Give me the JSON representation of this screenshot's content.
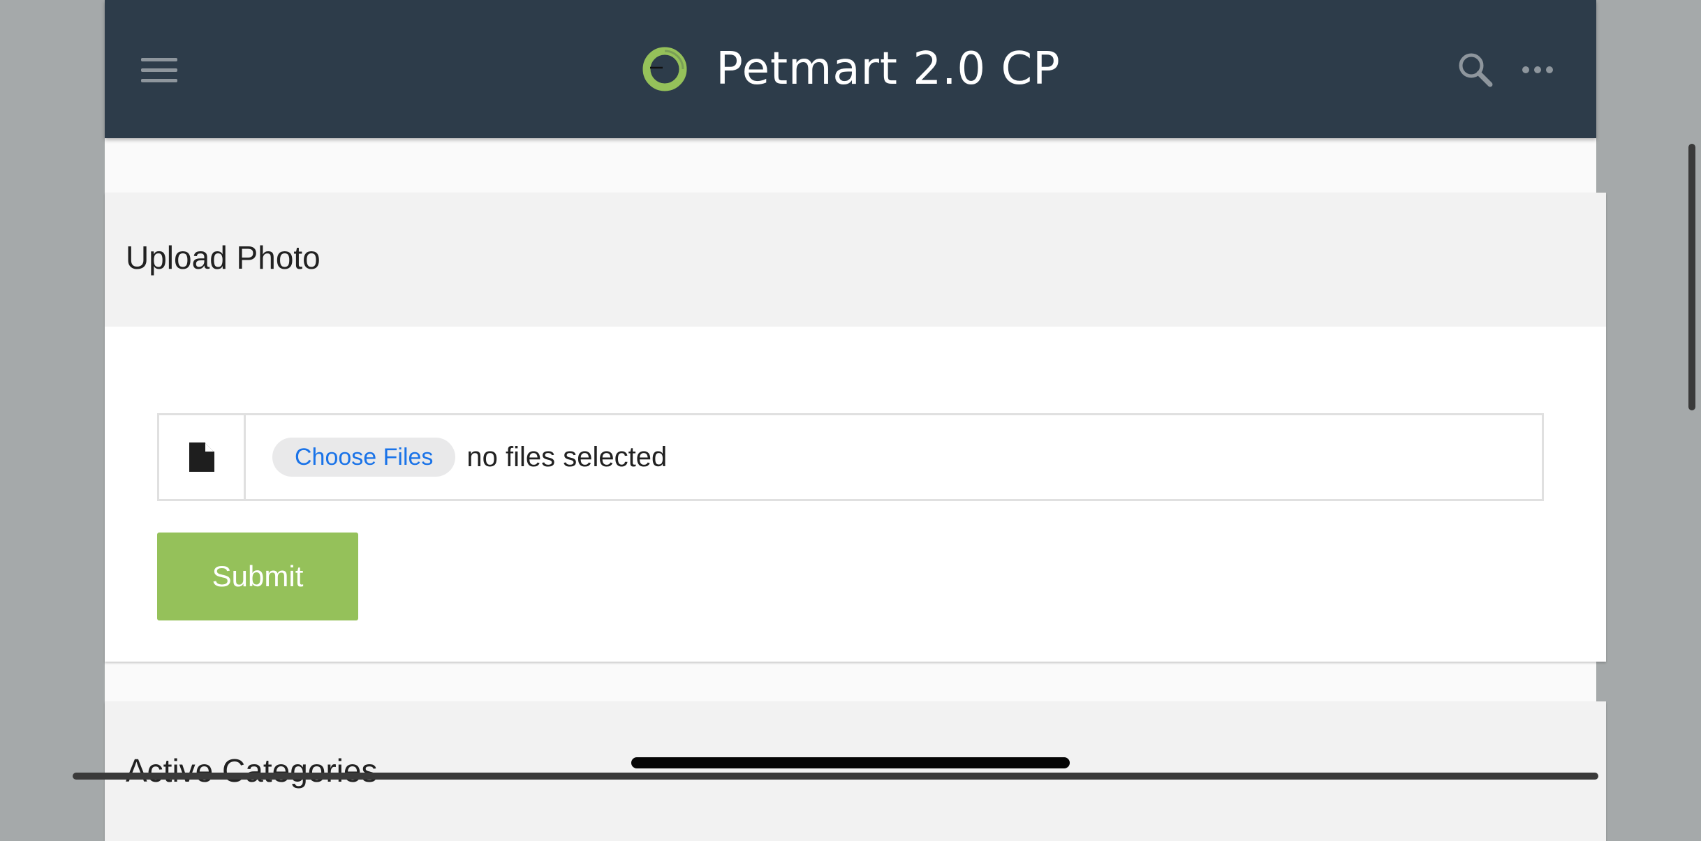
{
  "header": {
    "title": "Petmart 2.0 CP",
    "menu_icon": "hamburger-menu-icon",
    "logo_icon": "circle-logo-icon",
    "search_icon": "search-icon",
    "more_icon": "more-horizontal-icon",
    "background_color": "#2d3c4a",
    "logo_color": "#95c15a"
  },
  "upload_card": {
    "title": "Upload Photo",
    "file_icon": "document-icon",
    "choose_files_label": "Choose Files",
    "file_status": "no files selected",
    "submit_label": "Submit",
    "submit_color": "#95c15a",
    "choose_files_text_color": "#1a73e8"
  },
  "categories_card": {
    "title": "Active Categories"
  }
}
